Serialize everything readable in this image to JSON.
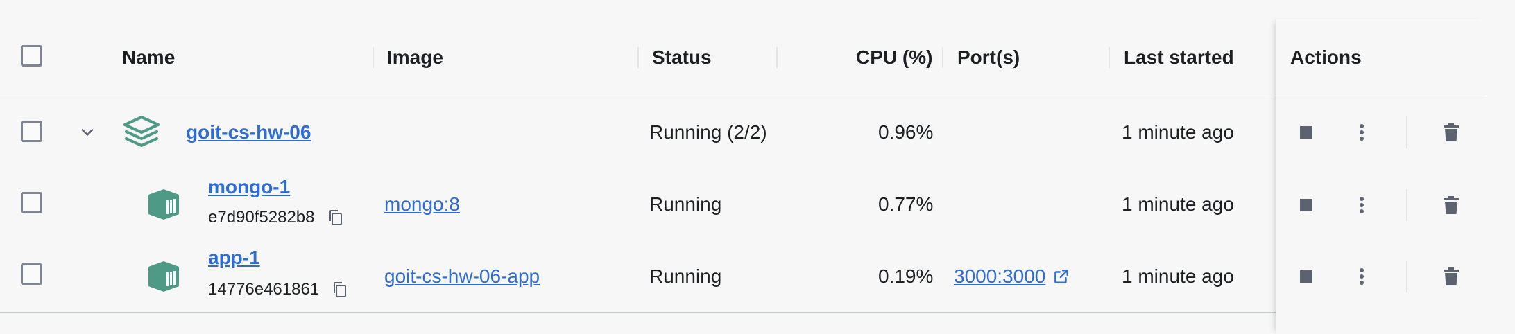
{
  "columns": {
    "name": "Name",
    "image": "Image",
    "status": "Status",
    "cpu": "CPU (%)",
    "ports": "Port(s)",
    "last_started": "Last started",
    "actions": "Actions"
  },
  "rows": [
    {
      "name": "goit-cs-hw-06",
      "status": "Running (2/2)",
      "cpu": "0.96%",
      "last_started": "1 minute ago",
      "icon": "stack-icon"
    },
    {
      "name": "mongo-1",
      "container_id": "e7d90f5282b8",
      "image": "mongo:8",
      "status": "Running",
      "cpu": "0.77%",
      "last_started": "1 minute ago",
      "icon": "container-icon"
    },
    {
      "name": "app-1",
      "container_id": "14776e461861",
      "image": "goit-cs-hw-06-app",
      "status": "Running",
      "cpu": "0.19%",
      "ports": "3000:3000",
      "last_started": "1 minute ago",
      "icon": "container-icon"
    }
  ],
  "colors": {
    "link": "#2f6cd1",
    "container_icon": "#4f9a87",
    "action_icon": "#5c6370",
    "checkbox_border": "#7d8594"
  }
}
